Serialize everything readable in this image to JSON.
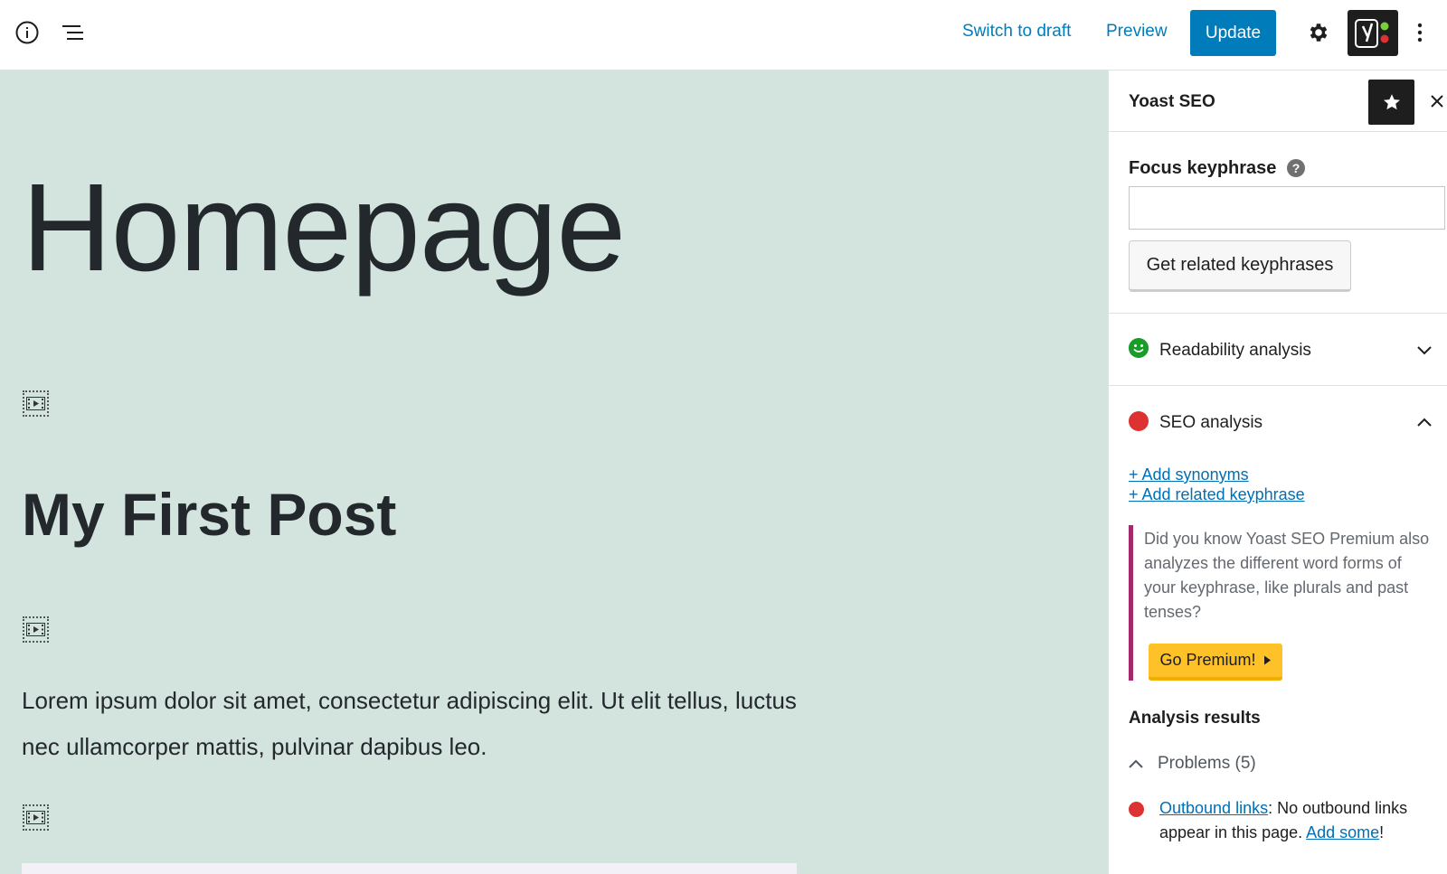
{
  "toolbar": {
    "switch_to_draft": "Switch to draft",
    "preview": "Preview",
    "update": "Update",
    "icons": [
      "info-icon",
      "list-view-icon",
      "gear-icon",
      "yoast-icon",
      "more-options-icon"
    ]
  },
  "editor": {
    "title": "Homepage",
    "heading": "My First Post",
    "paragraph": "Lorem ipsum dolor sit amet, consectetur adipiscing elit. Ut elit tellus, luctus nec ullamcorper mattis, pulvinar dapibus leo.",
    "background_color": "#d3e3dd"
  },
  "sidebar": {
    "title": "Yoast SEO",
    "focus_keyphrase_label": "Focus keyphrase",
    "focus_keyphrase_value": "",
    "help_glyph": "?",
    "related_button": "Get related keyphrases",
    "readability_label": "Readability analysis",
    "seo_label": "SEO analysis",
    "add_synonyms": "+ Add synonyms",
    "add_related": "+ Add related keyphrase",
    "promo_text": "Did you know Yoast SEO Premium also analyzes the different word forms of your keyphrase, like plurals and past tenses?",
    "premium_button": "Go Premium!",
    "analysis_results_title": "Analysis results",
    "problems_label": "Problems (5)",
    "result": {
      "link_text": "Outbound links",
      "message": ": No outbound links appear in this page. ",
      "action_link": "Add some",
      "suffix": "!"
    },
    "colors": {
      "readability_status": "#1a9c2b",
      "seo_status": "#dc3232",
      "premium": "#fec228",
      "promo_border": "#a4286a"
    }
  }
}
